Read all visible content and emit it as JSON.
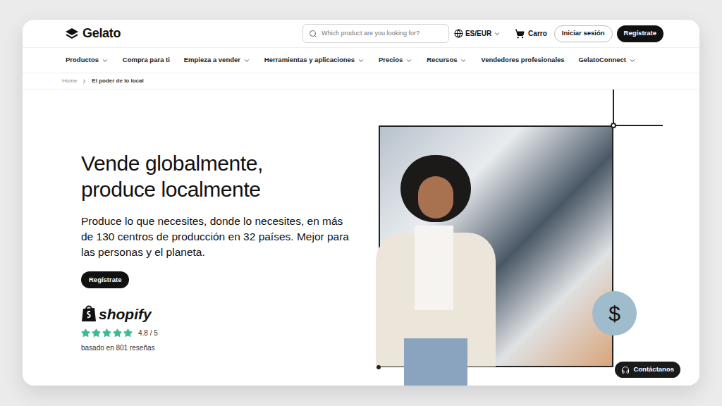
{
  "header": {
    "logo": "Gelato",
    "search": {
      "placeholder": "Which product are you looking for?"
    },
    "locale": "ES/EUR",
    "cart": "Carro",
    "login": "Iniciar sesión",
    "signup": "Regístrate"
  },
  "nav": [
    {
      "label": "Productos",
      "dropdown": true
    },
    {
      "label": "Compra para ti",
      "dropdown": false
    },
    {
      "label": "Empieza a vender",
      "dropdown": true
    },
    {
      "label": "Herramientas y aplicaciones",
      "dropdown": true
    },
    {
      "label": "Precios",
      "dropdown": true
    },
    {
      "label": "Recursos",
      "dropdown": true
    },
    {
      "label": "Vendedores profesionales",
      "dropdown": false
    },
    {
      "label": "GelatoConnect",
      "dropdown": true
    }
  ],
  "breadcrumb": [
    "Home",
    "El poder de lo local"
  ],
  "hero": {
    "title_lines": [
      "Vende globalmente,",
      "produce localmente"
    ],
    "subtitle": "Produce lo que necesites, donde lo necesites, en más de 130 centros de producción en 32 países. Mejor para las personas y el planeta.",
    "cta": "Regístrate",
    "rating": {
      "brand": "shopify",
      "stars": 5,
      "score": "4.8 / 5",
      "reviews": "basado en 801 reseñas"
    },
    "badge": "$"
  },
  "contact": "Contáctanos"
}
